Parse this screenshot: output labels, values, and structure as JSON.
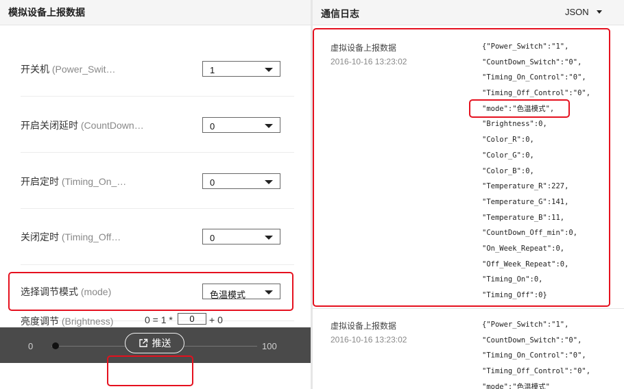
{
  "left_panel": {
    "title": "模拟设备上报数据",
    "properties": [
      {
        "label": "开关机",
        "code": "(Power_Swit…",
        "value": "1"
      },
      {
        "label": "开启关闭延时",
        "code": "(CountDown…",
        "value": "0"
      },
      {
        "label": "开启定时",
        "code": "(Timing_On_…",
        "value": "0"
      },
      {
        "label": "关闭定时",
        "code": "(Timing_Off…",
        "value": "0"
      },
      {
        "label": "选择调节模式",
        "code": "(mode)",
        "value": "色温模式"
      }
    ],
    "brightness": {
      "label": "亮度调节",
      "code": "(Brightness)",
      "formula_prefix": "0 = 1 *",
      "input_value": "0",
      "formula_suffix": "+ 0",
      "slider_min": "0",
      "slider_max": "100",
      "slider_value": 0
    },
    "push_button": {
      "label": "推送",
      "icon": "external-link-icon"
    }
  },
  "right_panel": {
    "title": "通信日志",
    "format_selector": "JSON",
    "entries": [
      {
        "title": "虚拟设备上报数据",
        "time": "2016-10-16 13:23:02",
        "lines": [
          "{\"Power_Switch\":\"1\",",
          "\"CountDown_Switch\":\"0\",",
          "\"Timing_On_Control\":\"0\",",
          "\"Timing_Off_Control\":\"0\",",
          "\"mode\":\"色温模式\",",
          "\"Brightness\":0,",
          "\"Color_R\":0,",
          "\"Color_G\":0,",
          "\"Color_B\":0,",
          "\"Temperature_R\":227,",
          "\"Temperature_G\":141,",
          "\"Temperature_B\":11,",
          "\"CountDown_Off_min\":0,",
          "\"On_Week_Repeat\":0,",
          "\"Off_Week_Repeat\":0,",
          "\"Timing_On\":0,",
          "\"Timing_Off\":0}"
        ]
      },
      {
        "title": "虚拟设备上报数据",
        "time": "2016-10-16 13:23:02",
        "lines": [
          "{\"Power_Switch\":\"1\",",
          "\"CountDown_Switch\":\"0\",",
          "\"Timing_On_Control\":\"0\",",
          "\"Timing_Off_Control\":\"0\",",
          "\"mode\":\"色温模式\""
        ]
      }
    ]
  },
  "colors": {
    "highlight": "#e5101e",
    "bottom_bar": "#3c3c3c",
    "header_bg": "#f5f5f5"
  }
}
